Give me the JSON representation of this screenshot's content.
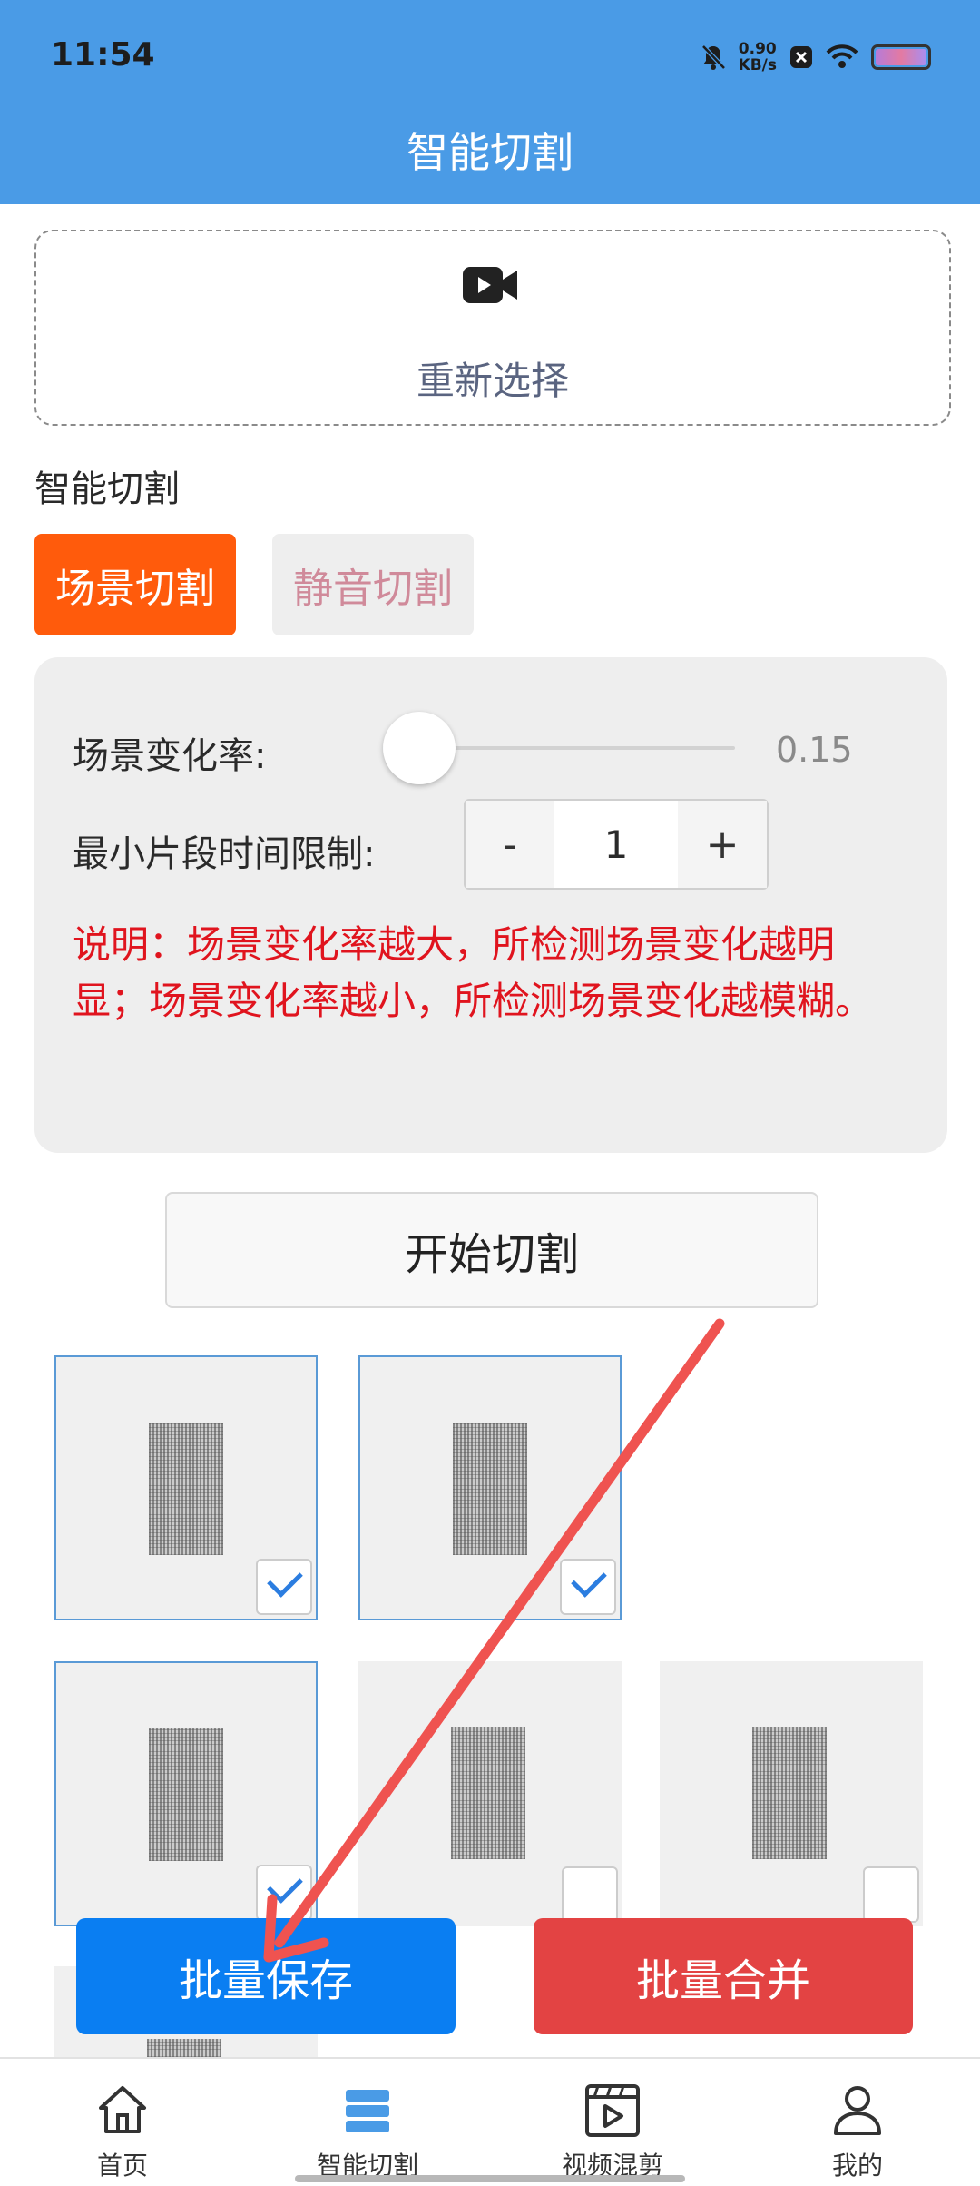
{
  "status_bar": {
    "time": "11:54",
    "net_speed_value": "0.90",
    "net_speed_unit": "KB/s"
  },
  "header": {
    "title": "智能切割"
  },
  "upload": {
    "icon": "video-camera-icon",
    "label": "重新选择"
  },
  "section": {
    "title": "智能切割"
  },
  "mode_tabs": [
    {
      "label": "场景切割",
      "active": true
    },
    {
      "label": "静音切割",
      "active": false
    }
  ],
  "settings": {
    "scene_rate_label": "场景变化率:",
    "scene_rate_value": "0.15",
    "scene_rate_fraction": 0.15,
    "min_segment_label": "最小片段时间限制:",
    "stepper_minus": "-",
    "stepper_value": "1",
    "stepper_plus": "+",
    "note": "说明：场景变化率越大，所检测场景变化越明显；场景变化率越小，所检测场景变化越模糊。"
  },
  "start_button": "开始切割",
  "thumbnails": [
    {
      "selected": true
    },
    {
      "selected": true
    },
    {
      "selected": true
    },
    {
      "selected": false
    },
    {
      "selected": false
    }
  ],
  "actions": {
    "batch_save": "批量保存",
    "batch_merge": "批量合并"
  },
  "nav": [
    {
      "label": "首页",
      "icon": "home-icon"
    },
    {
      "label": "智能切割",
      "icon": "cut-icon",
      "active": true
    },
    {
      "label": "视频混剪",
      "icon": "video-clip-icon"
    },
    {
      "label": "我的",
      "icon": "user-icon"
    }
  ],
  "colors": {
    "header": "#4a9be6",
    "active_tab": "#ff5b0c",
    "note_text": "#e0141e",
    "save_button": "#0a7ef2",
    "merge_button": "#e34343",
    "annotation_arrow": "#ef5350"
  }
}
